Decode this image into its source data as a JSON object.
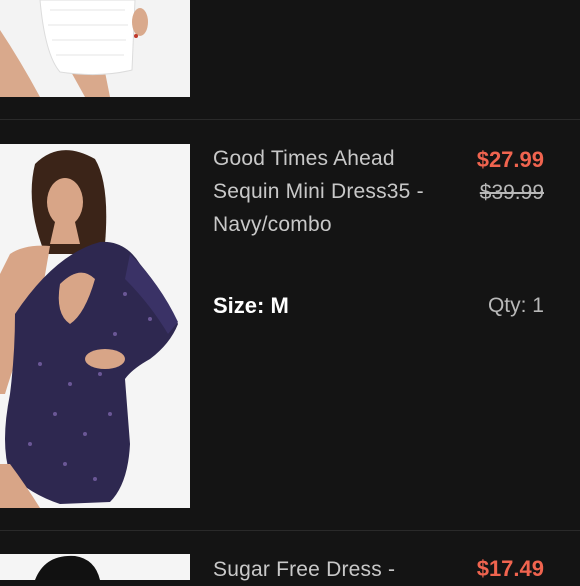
{
  "items": [
    {
      "image_desc": "product-photo-white-dress"
    },
    {
      "title": "Good Times Ahead Sequin Mini Dress35 - Navy/combo",
      "price": "$27.99",
      "original_price": "$39.99",
      "size_label": "Size: M",
      "qty_label": "Qty: 1"
    },
    {
      "title": "Sugar Free Dress -",
      "price": "$17.49"
    }
  ],
  "colors": {
    "background": "#141414",
    "price_accent": "#f0644f",
    "muted_text": "#b8b8b8"
  }
}
